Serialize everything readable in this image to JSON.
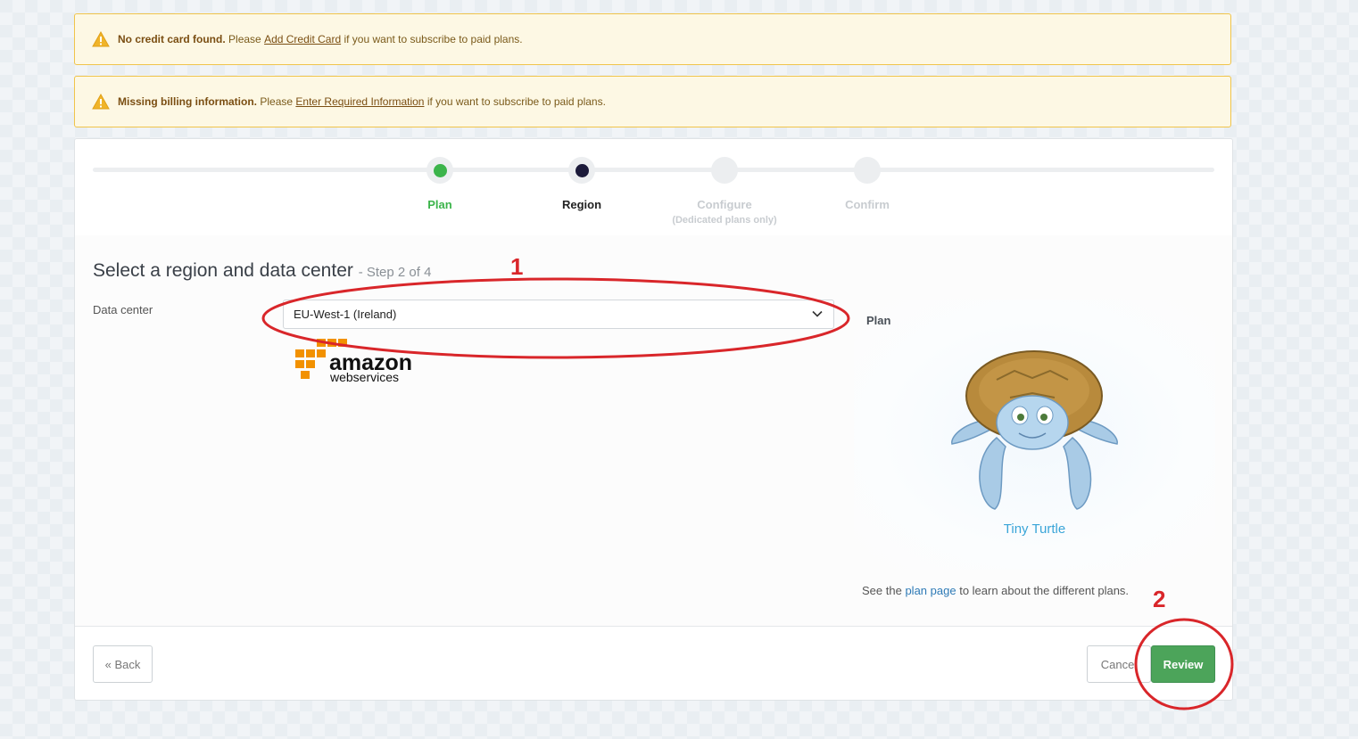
{
  "alerts": [
    {
      "title": "No credit card found.",
      "pre": "Please",
      "link": "Add Credit Card",
      "post": "if you want to subscribe to paid plans."
    },
    {
      "title": "Missing billing information.",
      "pre": "Please",
      "link": "Enter Required Information",
      "post": "if you want to subscribe to paid plans."
    }
  ],
  "steps": [
    {
      "label": "Plan",
      "sub": ""
    },
    {
      "label": "Region",
      "sub": ""
    },
    {
      "label": "Configure",
      "sub": "(Dedicated plans only)"
    },
    {
      "label": "Confirm",
      "sub": ""
    }
  ],
  "colors": {
    "done": "#3cb44b",
    "active": "#1c1a3a",
    "pending": "#c8ccd0",
    "annotation": "#d9262a"
  },
  "section": {
    "title": "Select a region and data center",
    "step_text": "- Step 2 of 4"
  },
  "data_center": {
    "label": "Data center",
    "value": "EU-West-1 (Ireland)"
  },
  "provider_logo": {
    "line1": "amazon",
    "line2": "webservices"
  },
  "plan": {
    "label": "Plan",
    "name": "Tiny Turtle",
    "note_pre": "See the",
    "note_link": "plan page",
    "note_post": "to learn about the different plans."
  },
  "buttons": {
    "back": "« Back",
    "cancel": "Cancel",
    "review": "Review"
  },
  "annotations": {
    "one": "1",
    "two": "2"
  }
}
